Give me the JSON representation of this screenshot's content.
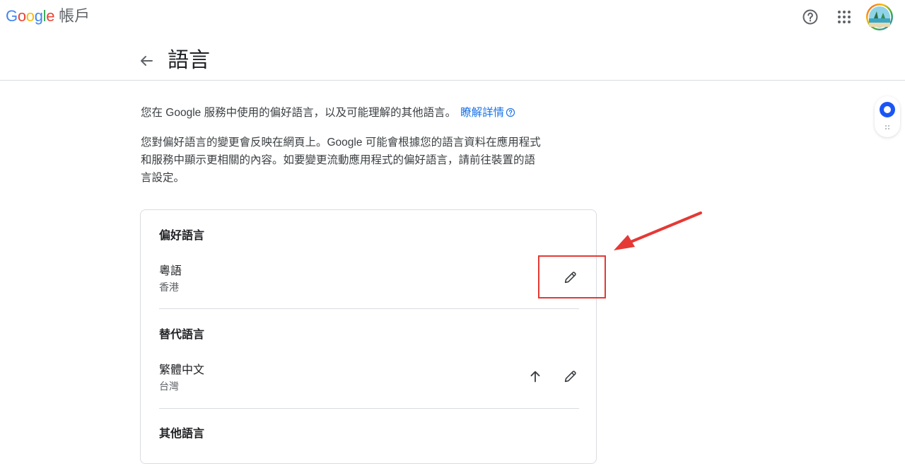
{
  "header": {
    "logo_letters": [
      {
        "ch": "G",
        "color": "#4285F4"
      },
      {
        "ch": "o",
        "color": "#EA4335"
      },
      {
        "ch": "o",
        "color": "#FBBC05"
      },
      {
        "ch": "g",
        "color": "#4285F4"
      },
      {
        "ch": "l",
        "color": "#34A853"
      },
      {
        "ch": "e",
        "color": "#EA4335"
      }
    ],
    "product_name": "帳戶",
    "help_icon": "help-circle-icon",
    "apps_icon": "apps-grid-icon",
    "avatar_icon": "user-avatar"
  },
  "page": {
    "title": "語言",
    "back_icon": "arrow-back-icon"
  },
  "intro": {
    "line1": "您在 Google 服務中使用的偏好語言，以及可能理解的其他語言。",
    "learn_more": "瞭解詳情",
    "paragraph": "您對偏好語言的變更會反映在網頁上。Google 可能會根據您的語言資料在應用程式和服務中顯示更相關的內容。如要變更流動應用程式的偏好語言，請前往裝置的語言設定。"
  },
  "sections": {
    "preferred": {
      "title": "偏好語言",
      "items": [
        {
          "name": "粵語",
          "region": "香港",
          "edit_icon": "pencil-icon"
        }
      ]
    },
    "alternate": {
      "title": "替代語言",
      "items": [
        {
          "name": "繁體中文",
          "region": "台灣",
          "move_up_icon": "arrow-up-icon",
          "edit_icon": "pencil-icon"
        }
      ]
    },
    "other": {
      "title": "其他語言"
    }
  },
  "colors": {
    "link": "#1a73e8",
    "annotation_red": "#e53935",
    "divider": "#dadce0",
    "text_primary": "#202124",
    "text_secondary": "#5f6368"
  }
}
